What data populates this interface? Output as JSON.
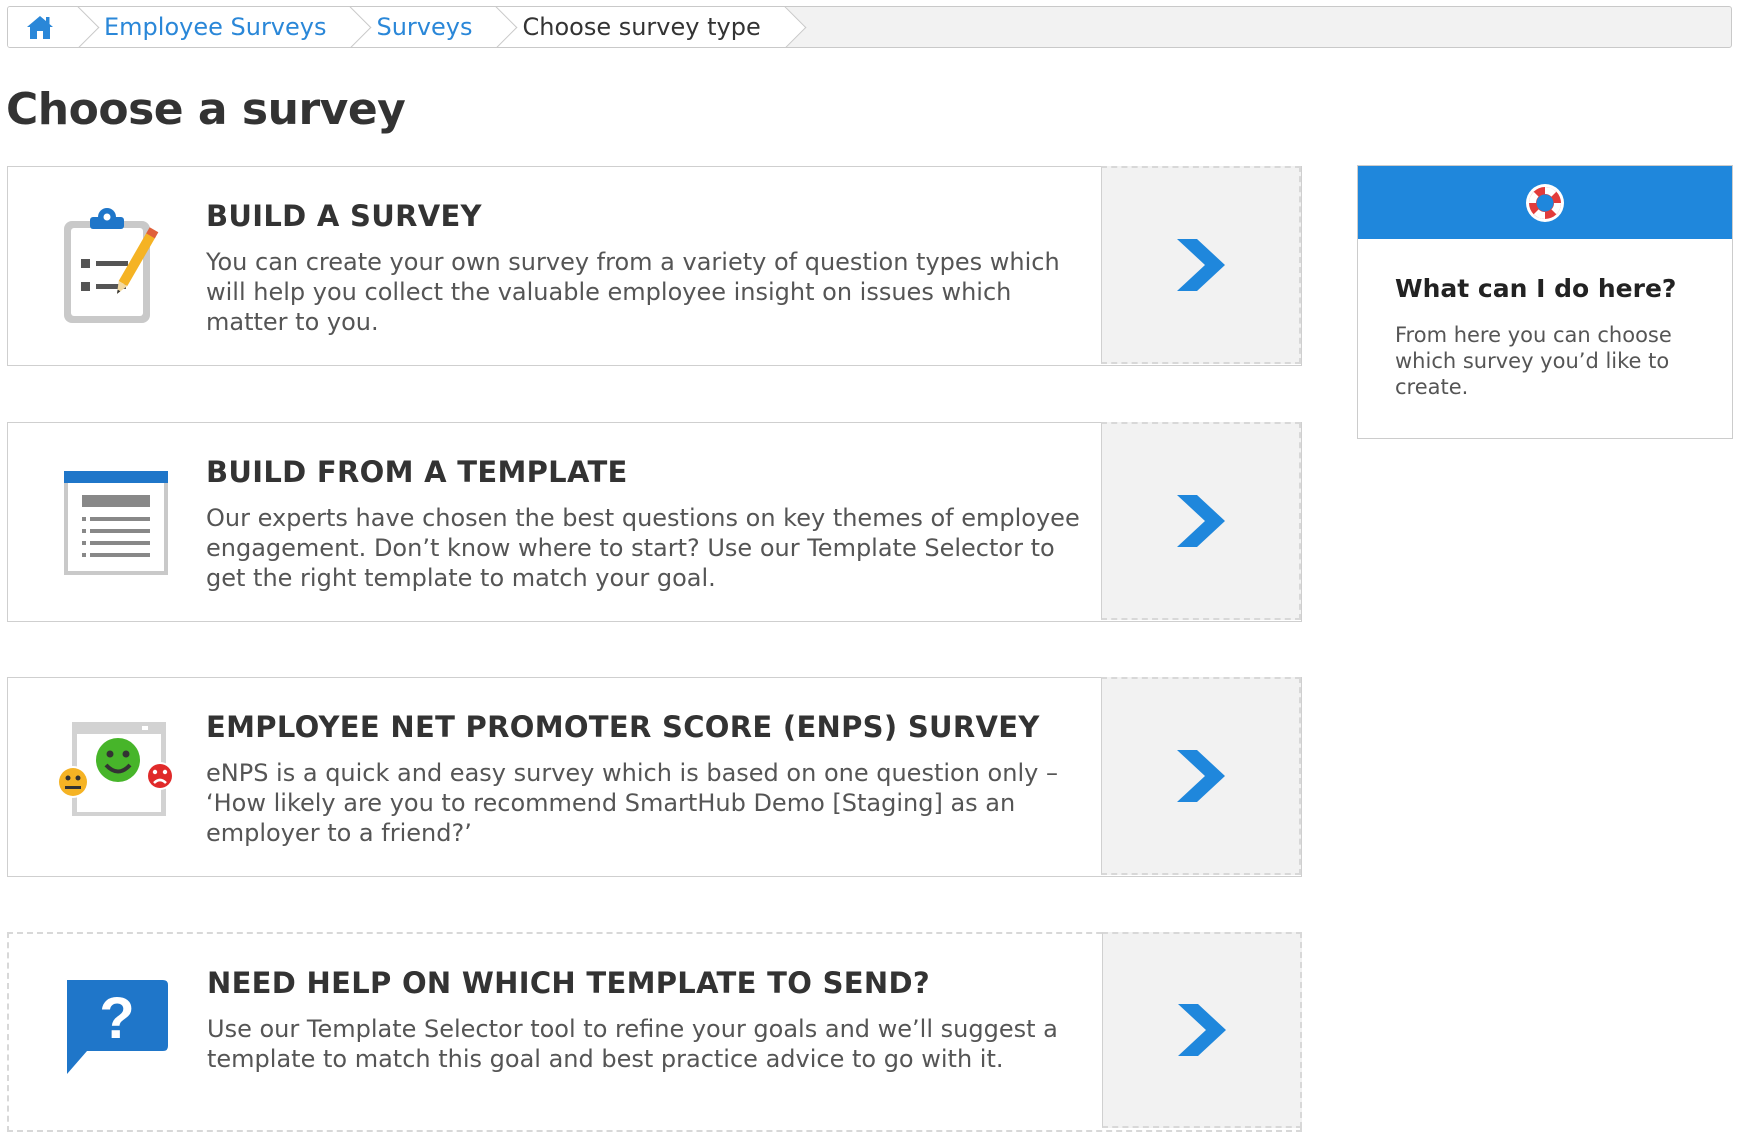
{
  "breadcrumb": {
    "items": [
      {
        "label": "Employee Surveys"
      },
      {
        "label": "Surveys"
      },
      {
        "label": "Choose survey type"
      }
    ]
  },
  "page": {
    "title": "Choose a survey"
  },
  "cards": [
    {
      "title": "BUILD A SURVEY",
      "description": "You can create your own survey from a variety of question types which will help you collect the valuable employee insight on issues which matter to you.",
      "icon": "clipboard-icon"
    },
    {
      "title": "BUILD FROM A TEMPLATE",
      "description": "Our experts have chosen the best questions on key themes of employee engagement. Don’t know where to start? Use our Template Selector to get the right template to match your goal.",
      "icon": "template-document-icon"
    },
    {
      "title": "EMPLOYEE NET PROMOTER SCORE (ENPS) SURVEY",
      "description": "eNPS is a quick and easy survey which is based on one question only – ‘How likely are you to recommend SmartHub Demo [Staging] as an employer to a friend?’",
      "icon": "smiley-faces-icon"
    },
    {
      "title": "NEED HELP ON WHICH TEMPLATE TO SEND?",
      "description": "Use our Template Selector tool to refine your goals and we’ll suggest a template to match this goal and best practice advice to go with it.",
      "icon": "question-bubble-icon"
    }
  ],
  "help": {
    "title": "What can I do here?",
    "text": "From here you can choose which survey you’d like to create.",
    "icon": "lifebuoy-icon"
  },
  "colors": {
    "accent": "#1f87dc",
    "link": "#2a87d8",
    "arrow_zone_bg": "#f2f2f2"
  }
}
